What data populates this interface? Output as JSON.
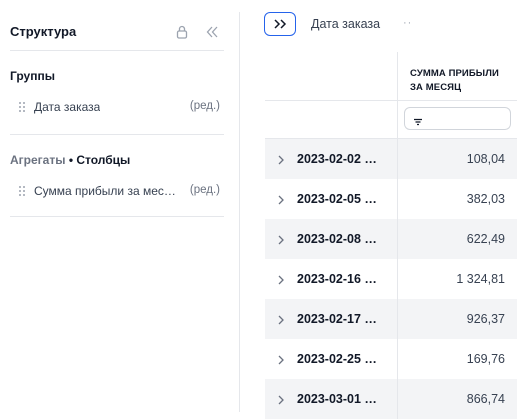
{
  "structure_panel": {
    "title": "Структура",
    "groups_title": "Группы",
    "group_items": [
      {
        "label": "Дата заказа",
        "edit": "(ред.)"
      }
    ],
    "aggregates_title": "Агрегаты",
    "aggregates_suffix": "• Столбцы",
    "aggregate_items": [
      {
        "label": "Сумма прибыли за мес…",
        "edit": "(ред.)"
      }
    ]
  },
  "toolbar": {
    "expand_label": ">>",
    "group_chip": "Дата заказа",
    "chip_more": "··"
  },
  "grid": {
    "column_header_line1": "СУММА ПРИБЫЛИ",
    "column_header_line2": "ЗА МЕСЯЦ",
    "rows": [
      {
        "date": "2023-02-02 …",
        "value": "108,04"
      },
      {
        "date": "2023-02-05 …",
        "value": "382,03"
      },
      {
        "date": "2023-02-08 …",
        "value": "622,49"
      },
      {
        "date": "2023-02-16 …",
        "value": "1 324,81"
      },
      {
        "date": "2023-02-17 …",
        "value": "926,37"
      },
      {
        "date": "2023-02-25 …",
        "value": "169,76"
      },
      {
        "date": "2023-03-01 …",
        "value": "866,74"
      }
    ]
  },
  "colors": {
    "accent": "#2563eb",
    "row_alt": "#f3f4f6",
    "divider": "#e5e7eb"
  }
}
